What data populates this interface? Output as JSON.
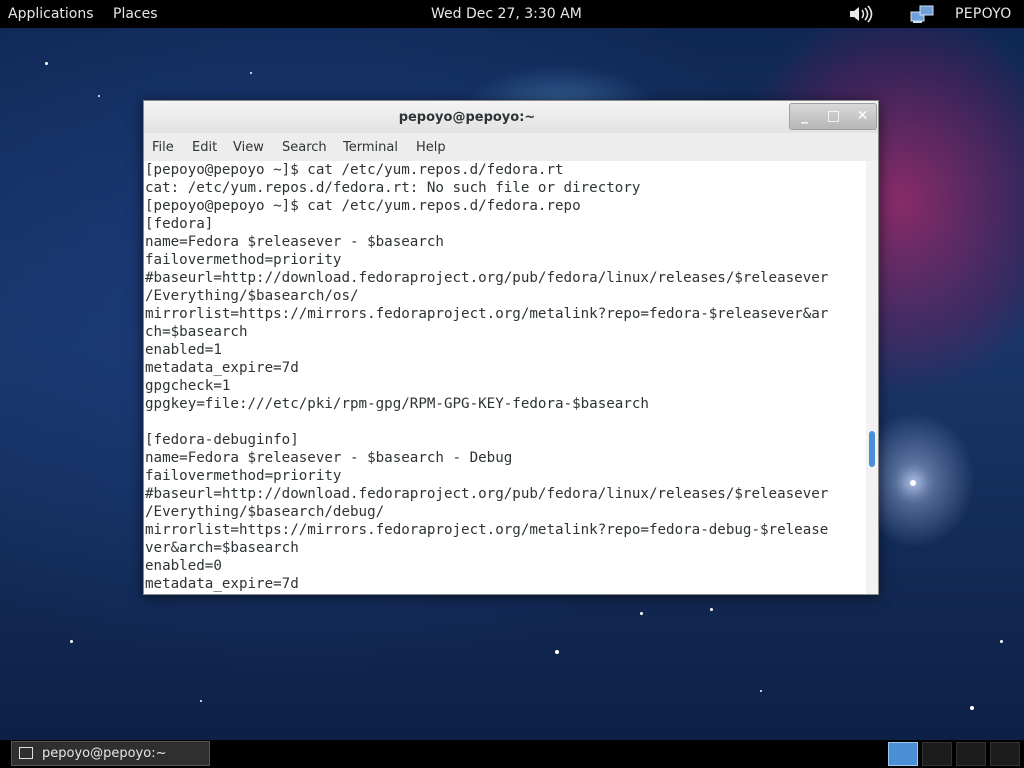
{
  "topbar": {
    "applications": "Applications",
    "places": "Places",
    "clock": "Wed Dec 27,  3:30 AM",
    "user": "PEPOYO",
    "volume_icon": "speaker-icon",
    "network_icon": "network-icon"
  },
  "window": {
    "title": "pepoyo@pepoyo:~",
    "menu": [
      "File",
      "Edit",
      "View",
      "Search",
      "Terminal",
      "Help"
    ],
    "buttons": {
      "minimize": "_",
      "maximize": "□",
      "close": "✕"
    },
    "terminal_lines": [
      "[pepoyo@pepoyo ~]$ cat /etc/yum.repos.d/fedora.rt",
      "cat: /etc/yum.repos.d/fedora.rt: No such file or directory",
      "[pepoyo@pepoyo ~]$ cat /etc/yum.repos.d/fedora.repo",
      "[fedora]",
      "name=Fedora $releasever - $basearch",
      "failovermethod=priority",
      "#baseurl=http://download.fedoraproject.org/pub/fedora/linux/releases/$releasever",
      "/Everything/$basearch/os/",
      "mirrorlist=https://mirrors.fedoraproject.org/metalink?repo=fedora-$releasever&ar",
      "ch=$basearch",
      "enabled=1",
      "metadata_expire=7d",
      "gpgcheck=1",
      "gpgkey=file:///etc/pki/rpm-gpg/RPM-GPG-KEY-fedora-$basearch",
      "",
      "[fedora-debuginfo]",
      "name=Fedora $releasever - $basearch - Debug",
      "failovermethod=priority",
      "#baseurl=http://download.fedoraproject.org/pub/fedora/linux/releases/$releasever",
      "/Everything/$basearch/debug/",
      "mirrorlist=https://mirrors.fedoraproject.org/metalink?repo=fedora-debug-$release",
      "ver&arch=$basearch",
      "enabled=0",
      "metadata_expire=7d"
    ]
  },
  "taskbar": {
    "task_label": "pepoyo@pepoyo:~",
    "workspaces": 4,
    "active_workspace": 1
  },
  "colors": {
    "accent": "#4a90d9",
    "terminal_text": "#2e3436",
    "panel": "#000000"
  }
}
